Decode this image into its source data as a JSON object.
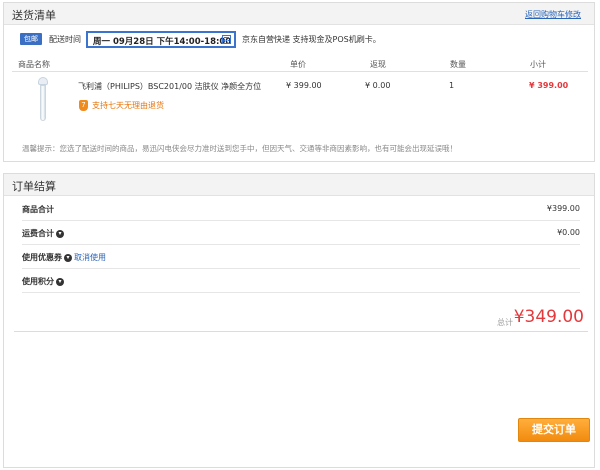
{
  "shipping": {
    "title": "送货清单",
    "back_link": "返回购物车修改",
    "baoyou_tag": "包邮",
    "delivery_time_label": "配送时间",
    "delivery_time_value": "周一 09月28日 下午14:00-18:00",
    "shipping_note": "京东自营快递  支持现金及POS机刷卡。",
    "columns": [
      "商品名称",
      "单价",
      "返现",
      "数量",
      "小计"
    ],
    "item": {
      "name": "飞利浦（PHILIPS）BSC201/00 洁肤仪 净颜全方位",
      "return_policy": "支持七天无理由退货",
      "return_badge": "7",
      "unit_price": "¥ 399.00",
      "cashback": "¥ 0.00",
      "quantity": "1",
      "subtotal": "¥ 399.00"
    },
    "tip": "温馨提示：您选了配送时间的商品，易迅闪电侠会尽力准时送到您手中，但因天气、交通等非商因素影响，也有可能会出现延误哦！"
  },
  "settlement": {
    "title": "订单结算",
    "rows": [
      {
        "label": "商品合计",
        "value": "¥399.00"
      },
      {
        "label": "运费合计",
        "value": "¥0.00"
      },
      {
        "label": "使用优惠券",
        "value": ""
      },
      {
        "label": "使用积分",
        "value": ""
      }
    ],
    "cancel_use": "取消使用",
    "total_label": "总计",
    "total_value": "¥349.00",
    "submit_label": "提交订单"
  },
  "colors": {
    "accent_blue": "#3b74cf",
    "price_red": "#e4393c",
    "button_orange": "#f28b0f"
  }
}
